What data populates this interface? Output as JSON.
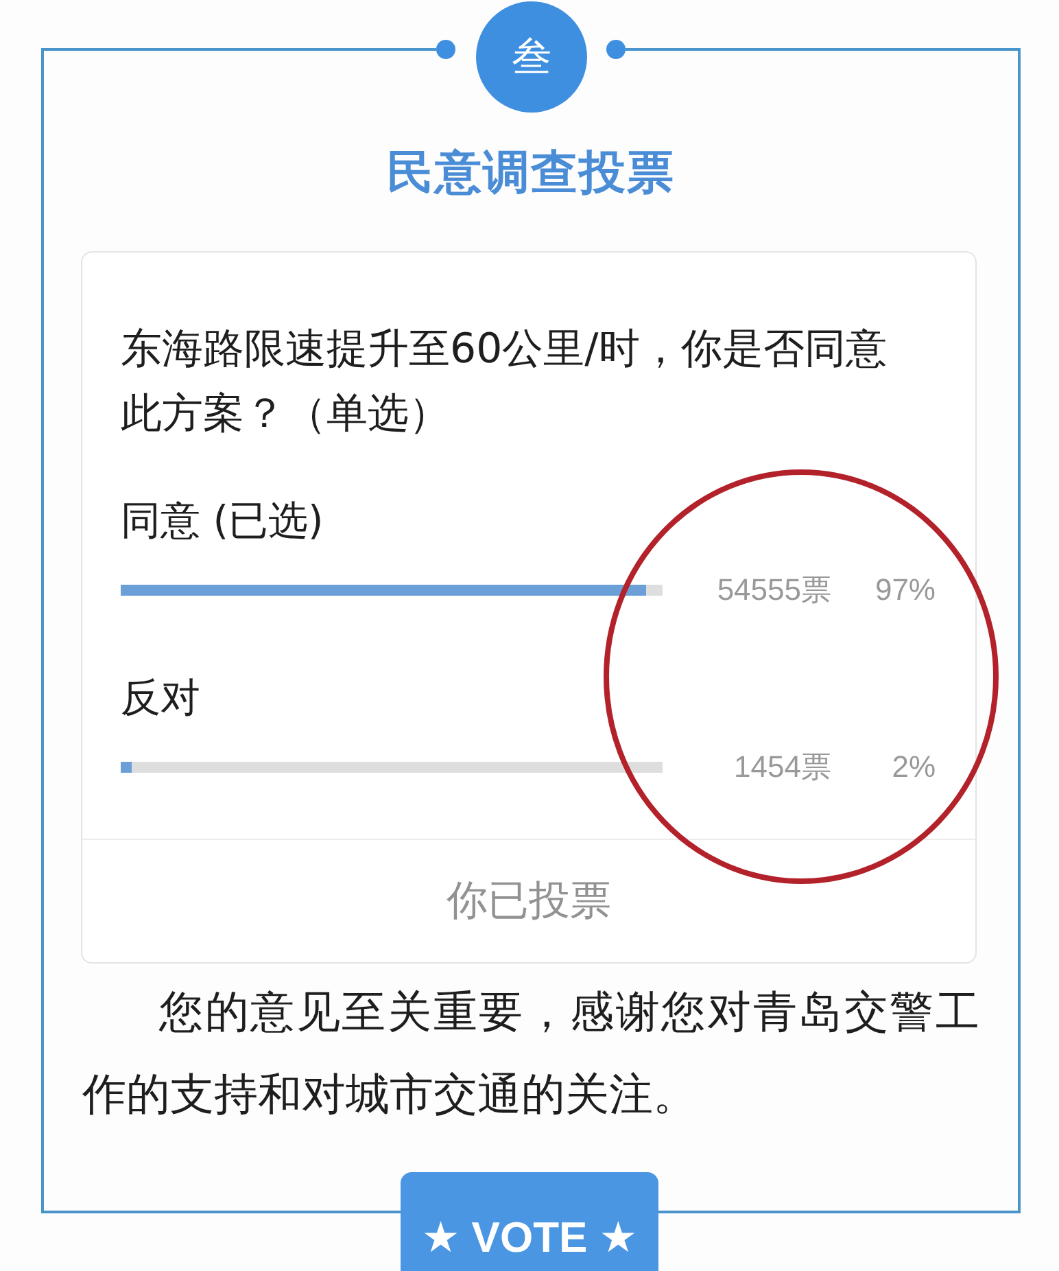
{
  "section": {
    "number": "叁",
    "title": "民意调查投票"
  },
  "poll": {
    "question": "东海路限速提升至60公里/时，你是否同意此方案？（单选）",
    "options": [
      {
        "label": "同意 (已选)",
        "level": 0.97,
        "votes": "54555票",
        "percent": "97%"
      },
      {
        "label": "反对",
        "level": 0.02,
        "votes": "1454票",
        "percent": "2%"
      }
    ],
    "status": {
      "label": "你已投票",
      "disabled": true
    }
  },
  "annotation": {
    "kind": "ellipse"
  },
  "message": "您的意见至关重要，感谢您对青岛交警工作的支持和对城市交通的关注。",
  "vote_button": {
    "label": "★ VOTE ★"
  }
}
